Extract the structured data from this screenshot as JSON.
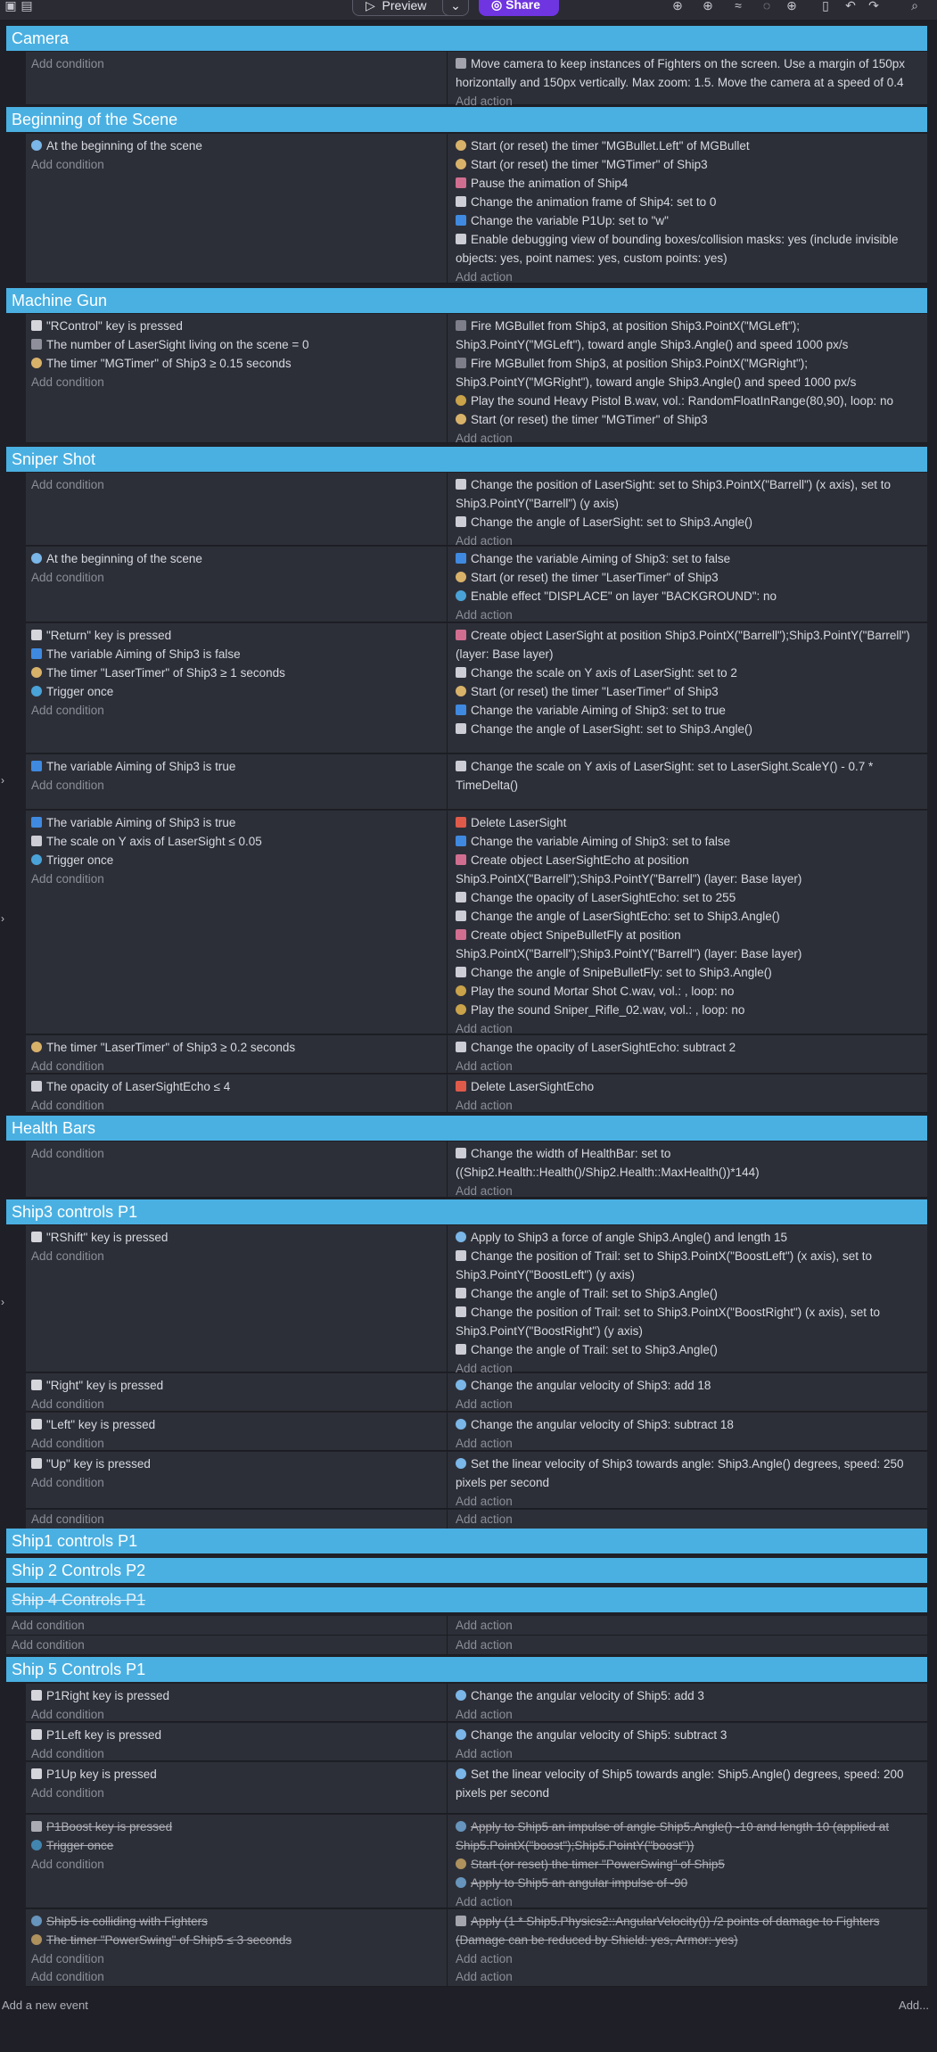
{
  "toolbar": {
    "preview_label": "Preview",
    "share_label": "Share",
    "dropdown_glyph": "⌄"
  },
  "groups": {
    "camera": "Camera",
    "beginning": "Beginning of the Scene",
    "machine_gun": "Machine Gun",
    "sniper": "Sniper Shot",
    "health": "Health Bars",
    "ship3": "Ship3 controls P1",
    "ship1": "Ship1 controls P1",
    "ship2": "Ship 2 Controls P2",
    "ship4": "Ship 4 Controls P1",
    "ship5": "Ship 5 Controls P1"
  },
  "common": {
    "add_condition": "Add condition",
    "add_action": "Add action"
  },
  "events": {
    "camera": {
      "actions": [
        "Move camera to keep instances of Fighters on the screen. Use a margin of 150px horizontally and 150px vertically. Max zoom: 1.5. Move the camera at a speed of 0.4"
      ]
    },
    "beginning": {
      "conditions": [
        "At the beginning of the scene"
      ],
      "actions": [
        "Start (or reset) the timer \"MGBullet.Left\" of MGBullet",
        "Start (or reset) the timer \"MGTimer\" of Ship3",
        "Pause the animation of Ship4",
        "Change the animation frame of Ship4: set to 0",
        "Change the variable P1Up: set to \"w\"",
        "Enable debugging view of bounding boxes/collision masks: yes (include invisible objects: yes, point names: yes, custom points: yes)"
      ]
    },
    "mg": {
      "conditions": [
        "\"RControl\" key is pressed",
        "The number of LaserSight living on the scene = 0",
        "The timer \"MGTimer\" of Ship3 ≥ 0.15 seconds"
      ],
      "actions": [
        "Fire MGBullet from Ship3, at position Ship3.PointX(\"MGLeft\"); Ship3.PointY(\"MGLeft\"), toward angle Ship3.Angle() and speed 1000 px/s",
        "Fire MGBullet from Ship3, at position Ship3.PointX(\"MGRight\"); Ship3.PointY(\"MGRight\"), toward angle Ship3.Angle() and speed 1000 px/s",
        "Play the sound Heavy Pistol B.wav, vol.: RandomFloatInRange(80,90), loop: no",
        "Start (or reset) the timer \"MGTimer\" of Ship3"
      ]
    },
    "sn1": {
      "actions": [
        "Change the position of LaserSight: set to Ship3.PointX(\"Barrell\") (x axis), set to Ship3.PointY(\"Barrell\") (y axis)",
        "Change the angle of LaserSight: set to Ship3.Angle()"
      ]
    },
    "sn2": {
      "conditions": [
        "At the beginning of the scene"
      ],
      "actions": [
        "Change the variable Aiming of Ship3: set to false",
        "Start (or reset) the timer \"LaserTimer\" of Ship3",
        "Enable effect \"DISPLACE\" on layer \"BACKGROUND\": no"
      ]
    },
    "sn3": {
      "conditions": [
        "\"Return\" key is pressed",
        "The variable Aiming of Ship3 is false",
        "The timer \"LaserTimer\" of Ship3 ≥ 1 seconds",
        "Trigger once"
      ],
      "actions": [
        "Create object LaserSight at position Ship3.PointX(\"Barrell\");Ship3.PointY(\"Barrell\") (layer: Base layer)",
        "Change the scale on Y axis of LaserSight: set to 2",
        "Start (or reset) the timer \"LaserTimer\" of Ship3",
        "Change the variable Aiming of Ship3: set to true",
        "Change the angle of LaserSight: set to Ship3.Angle()"
      ]
    },
    "sn4": {
      "conditions": [
        "The variable Aiming of Ship3 is true"
      ],
      "actions": [
        "Change the scale on Y axis of LaserSight: set to LaserSight.ScaleY() - 0.7 * TimeDelta()"
      ]
    },
    "sn5": {
      "conditions": [
        "The variable Aiming of Ship3 is true",
        "The scale on Y axis of LaserSight ≤ 0.05",
        "Trigger once"
      ],
      "actions": [
        "Delete LaserSight",
        "Change the variable Aiming of Ship3: set to false",
        "Create object LaserSightEcho at position Ship3.PointX(\"Barrell\");Ship3.PointY(\"Barrell\") (layer: Base layer)",
        "Change the opacity of LaserSightEcho: set to 255",
        "Change the angle of LaserSightEcho: set to Ship3.Angle()",
        "Create object SnipeBulletFly at position Ship3.PointX(\"Barrell\");Ship3.PointY(\"Barrell\") (layer: Base layer)",
        "Change the angle of SnipeBulletFly: set to Ship3.Angle()",
        "Play the sound Mortar Shot C.wav, vol.: , loop: no",
        "Play the sound Sniper_Rifle_02.wav, vol.: , loop: no"
      ]
    },
    "sn6": {
      "conditions": [
        "The timer \"LaserTimer\" of Ship3 ≥ 0.2 seconds"
      ],
      "actions": [
        "Change the opacity of LaserSightEcho: subtract 2"
      ]
    },
    "sn7": {
      "conditions": [
        "The opacity of LaserSightEcho ≤ 4"
      ],
      "actions": [
        "Delete LaserSightEcho"
      ]
    },
    "hb": {
      "actions": [
        "Change the width of HealthBar: set to ((Ship2.Health::Health()/Ship2.Health::MaxHealth())*144)"
      ]
    },
    "s3a": {
      "conditions": [
        "\"RShift\" key is pressed"
      ],
      "actions": [
        "Apply to Ship3 a force of angle Ship3.Angle() and length 15",
        "Change the position of Trail: set to Ship3.PointX(\"BoostLeft\") (x axis), set to Ship3.PointY(\"BoostLeft\") (y axis)",
        "Change the angle of Trail: set to Ship3.Angle()",
        "Change the position of Trail: set to Ship3.PointX(\"BoostRight\") (x axis), set to Ship3.PointY(\"BoostRight\") (y axis)",
        "Change the angle of Trail: set to Ship3.Angle()"
      ]
    },
    "s3b": {
      "conditions": [
        "\"Right\" key is pressed"
      ],
      "actions": [
        "Change the angular velocity of Ship3: add 18"
      ]
    },
    "s3c": {
      "conditions": [
        "\"Left\" key is pressed"
      ],
      "actions": [
        "Change the angular velocity of Ship3: subtract 18"
      ]
    },
    "s3d": {
      "conditions": [
        "\"Up\" key is pressed"
      ],
      "actions": [
        "Set the linear velocity of Ship3 towards angle: Ship3.Angle() degrees, speed: 250 pixels per second"
      ]
    },
    "s5a": {
      "conditions": [
        "P1Right key is pressed"
      ],
      "actions": [
        "Change the angular velocity of Ship5: add 3"
      ]
    },
    "s5b": {
      "conditions": [
        "P1Left key is pressed"
      ],
      "actions": [
        "Change the angular velocity of Ship5: subtract 3"
      ]
    },
    "s5c": {
      "conditions": [
        "P1Up key is pressed"
      ],
      "actions": [
        "Set the linear velocity of Ship5 towards angle: Ship5.Angle() degrees, speed: 200 pixels per second"
      ]
    },
    "s5d": {
      "conditions": [
        "P1Boost key is pressed",
        "Trigger once"
      ],
      "actions": [
        "Apply to Ship5 an impulse of angle Ship5.Angle() -10 and length 10 (applied at Ship5.PointX(\"boost\");Ship5.PointY(\"boost\"))",
        "Start (or reset) the timer \"PowerSwing\" of Ship5",
        "Apply to Ship5 an angular impulse of -90"
      ]
    },
    "s5e": {
      "conditions": [
        "Ship5 is colliding with Fighters",
        "The timer \"PowerSwing\" of Ship5 ≤ 3 seconds"
      ],
      "actions": [
        "Apply (1 * Ship5.Physics2::AngularVelocity()) /2 points of damage to Fighters (Damage can be reduced by Shield: yes, Armor: yes)"
      ]
    }
  },
  "footer": {
    "add_event": "Add a new event",
    "add_more": "Add..."
  }
}
